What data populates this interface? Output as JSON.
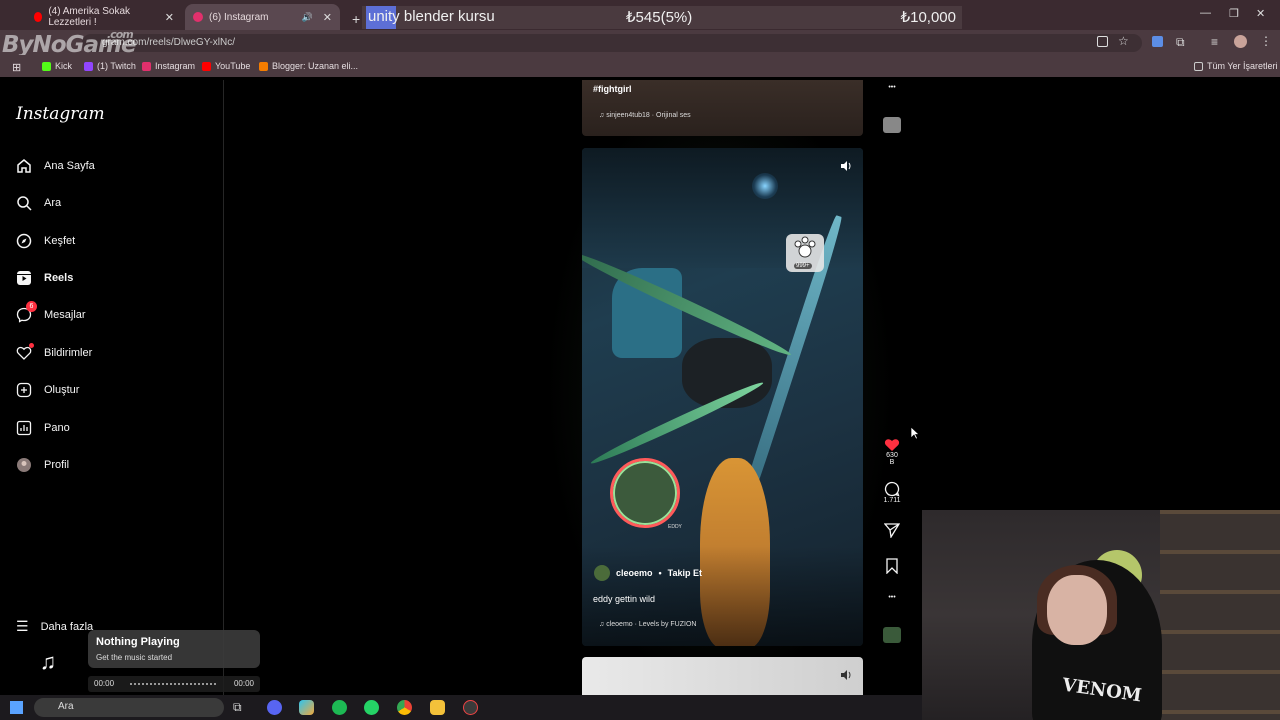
{
  "browser": {
    "tabs": [
      {
        "label": "(4) Amerika Sokak Lezzetleri !",
        "active": false,
        "color": "#ff0000"
      },
      {
        "label": "(6) Instagram",
        "active": true,
        "color": "#e1306c"
      }
    ],
    "new_tab_label": "+",
    "url": "gram.com/reels/DlweGY-xlNc/",
    "watermark": "ByNoGame",
    "watermark_suffix": ".com",
    "bookmarks": [
      {
        "label": "Kick",
        "color": "#53fc18"
      },
      {
        "label": "(1) Twitch",
        "color": "#9146ff"
      },
      {
        "label": "Instagram",
        "color": "#e1306c"
      },
      {
        "label": "YouTube",
        "color": "#ff0000"
      },
      {
        "label": "Blogger: Uzanan eli...",
        "color": "#f57d00"
      }
    ],
    "all_bookmarks_label": "Tüm Yer İşaretleri"
  },
  "donation_overlay": {
    "title": "unity blender kursu",
    "current": "₺545(5%)",
    "goal": "₺10,000",
    "progress_percent": 5
  },
  "sidebar": {
    "logo": "Instagram",
    "items": [
      {
        "label": "Ana Sayfa",
        "icon": "home-icon"
      },
      {
        "label": "Ara",
        "icon": "search-icon"
      },
      {
        "label": "Keşfet",
        "icon": "compass-icon"
      },
      {
        "label": "Reels",
        "icon": "reels-icon",
        "active": true
      },
      {
        "label": "Mesajlar",
        "icon": "messenger-icon",
        "badge": "6"
      },
      {
        "label": "Bildirimler",
        "icon": "heart-icon"
      },
      {
        "label": "Oluştur",
        "icon": "plus-square-icon"
      },
      {
        "label": "Pano",
        "icon": "chart-icon"
      },
      {
        "label": "Profil",
        "icon": "avatar-icon"
      }
    ],
    "more_label": "Daha fazla"
  },
  "reels": {
    "previous": {
      "hashtag": "#fightgirl",
      "audio": "sinjeen4tub18 · Orijinal ses"
    },
    "current": {
      "author": "cleoemo",
      "follow_label": "Takip Et",
      "separator": "•",
      "caption": "eddy gettin wild",
      "audio": "cleoemo · Levels by FUZION",
      "badge_count": "999+",
      "radar_label": "EDDY",
      "likes": "630 B",
      "comments": "1.711"
    }
  },
  "music_widget": {
    "title": "Nothing Playing",
    "subtitle": "Get the music started",
    "time_current": "00:00",
    "time_total": "00:00"
  },
  "taskbar": {
    "search_label": "Ara",
    "apps": [
      "discord-icon",
      "copilot-icon",
      "spotify-icon",
      "whatsapp-icon",
      "chrome-icon",
      "files-icon",
      "game-icon"
    ]
  },
  "webcam": {
    "shirt_text": "VENOM"
  },
  "colors": {
    "like_red": "#ff3040",
    "ig_bg": "#000000"
  }
}
